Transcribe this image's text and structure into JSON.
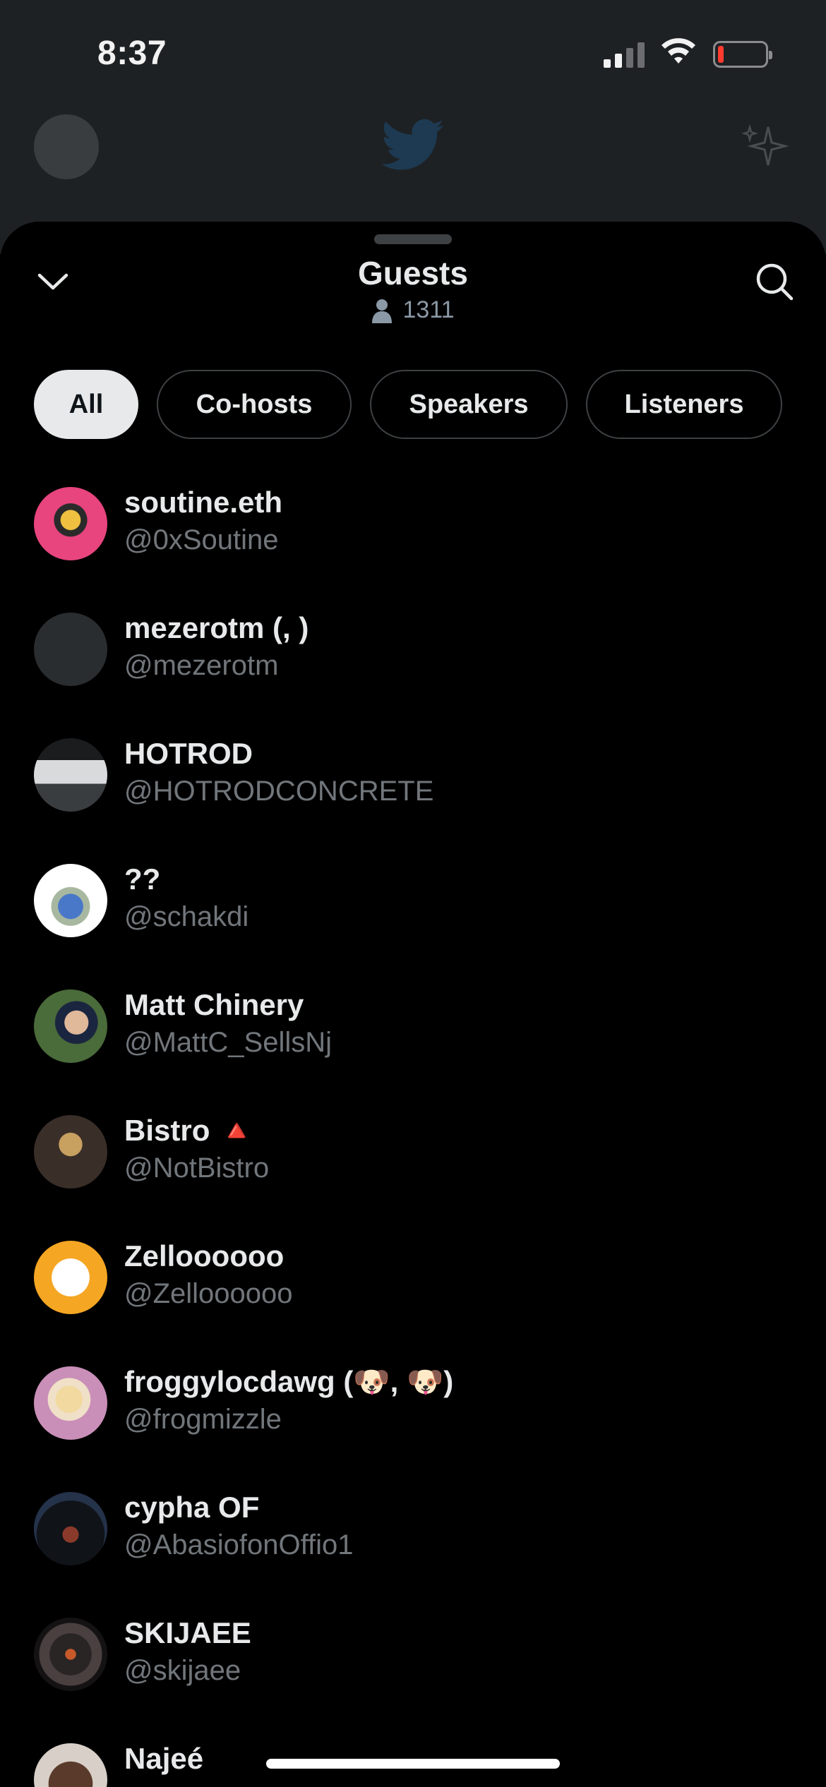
{
  "status_bar": {
    "time": "8:37"
  },
  "sheet": {
    "title": "Guests",
    "guest_count": "1311"
  },
  "filters": [
    {
      "label": "All",
      "active": true
    },
    {
      "label": "Co-hosts",
      "active": false
    },
    {
      "label": "Speakers",
      "active": false
    },
    {
      "label": "Listeners",
      "active": false
    }
  ],
  "guests": [
    {
      "name": "soutine.eth",
      "handle": "@0xSoutine",
      "avatar_color": "#d9477a"
    },
    {
      "name": "mezerotm (, )",
      "handle": "@mezerotm",
      "avatar_color": "#2a2d30"
    },
    {
      "name": "HOTROD",
      "handle": "@HOTRODCONCRETE",
      "avatar_color": "#8a8d90"
    },
    {
      "name": "??",
      "handle": "@schakdi",
      "avatar_color": "#ffffff"
    },
    {
      "name": "Matt Chinery",
      "handle": "@MattC_SellsNj",
      "avatar_color": "#4a6b3a"
    },
    {
      "name": "Bistro 🔺",
      "handle": "@NotBistro",
      "avatar_color": "#5a4a3a"
    },
    {
      "name": "Zelloooooo",
      "handle": "@Zelloooooo",
      "avatar_color": "#f5a623"
    },
    {
      "name": "froggylocdawg (🐶, 🐶)",
      "handle": "@frogmizzle",
      "avatar_color": "#c98fb8"
    },
    {
      "name": "cypha OF",
      "handle": "@AbasiofonOffio1",
      "avatar_color": "#1c2535"
    },
    {
      "name": "SKIJAEE",
      "handle": "@skijaee",
      "avatar_color": "#3a3030"
    },
    {
      "name": "Najeé",
      "handle": "",
      "avatar_color": "#5a3a2a"
    }
  ],
  "colors": {
    "accent": "#1d9bf0",
    "background": "#000000",
    "secondary_text": "#71767b"
  }
}
